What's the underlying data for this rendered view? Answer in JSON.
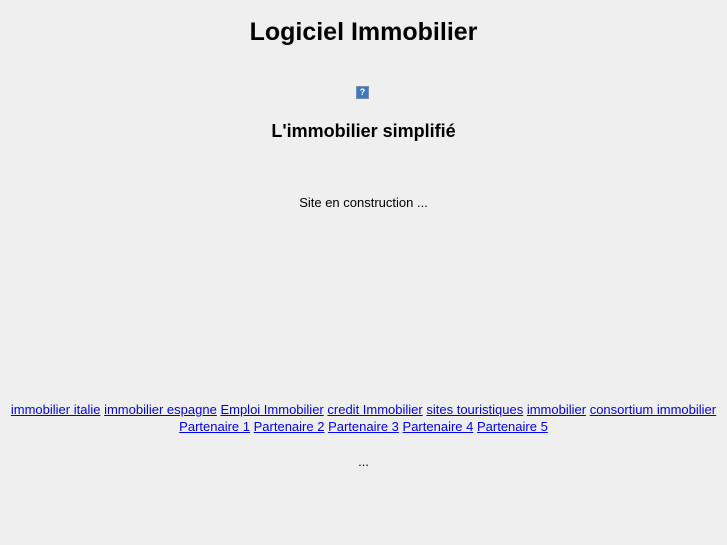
{
  "header": {
    "title": "Logiciel Immobilier",
    "image_alt_glyph": "?",
    "subtitle": "L'immobilier simplifié"
  },
  "main": {
    "status": "Site en construction ..."
  },
  "links": {
    "row1": [
      "immobilier italie",
      "immobilier espagne",
      "Emploi Immobilier",
      "credit Immobilier",
      "sites touristiques",
      "immobilier",
      "consortium immobilier"
    ],
    "row2": [
      "Partenaire 1",
      "Partenaire 2",
      "Partenaire 3",
      "Partenaire 4",
      "Partenaire 5"
    ]
  },
  "footer": {
    "ellipsis": "..."
  }
}
